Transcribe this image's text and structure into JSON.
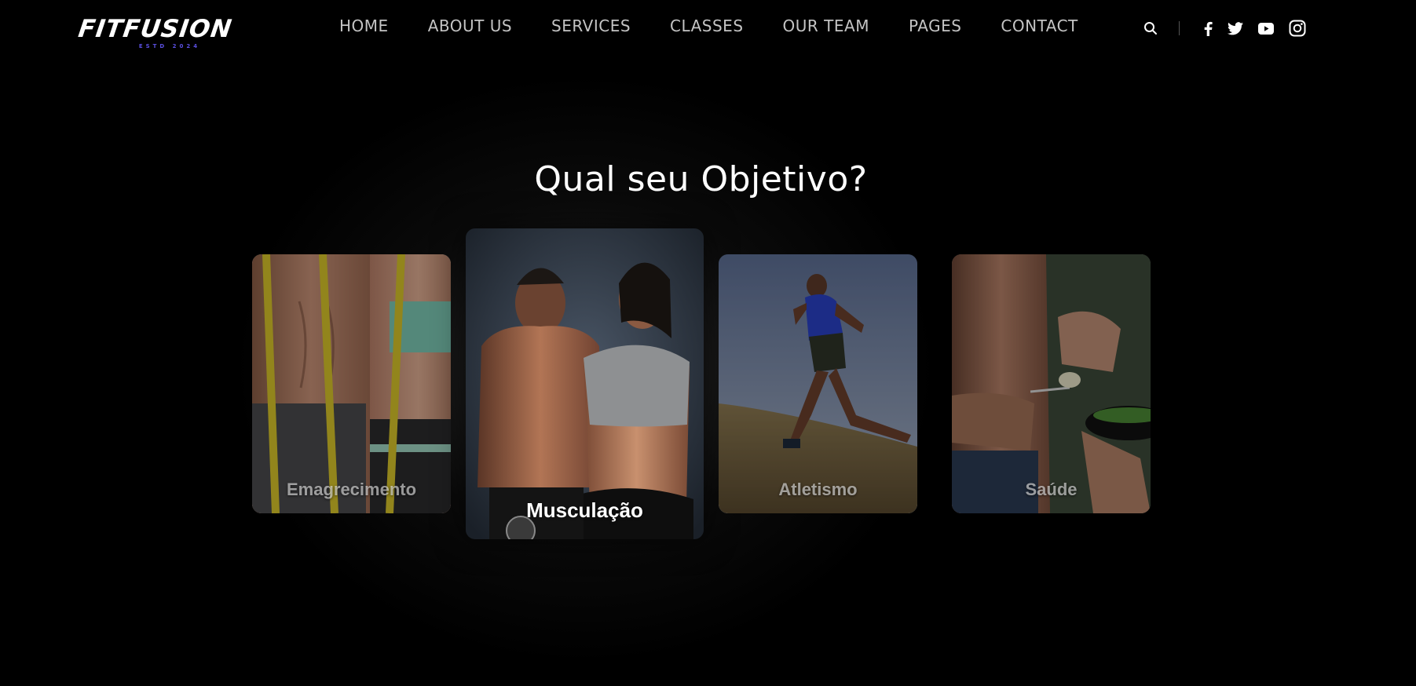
{
  "brand": {
    "name": "FITFUSION",
    "tagline": "ESTD 2024",
    "accent_color": "#5a4fe0"
  },
  "nav": {
    "items": [
      {
        "label": "HOME"
      },
      {
        "label": "ABOUT US"
      },
      {
        "label": "SERVICES"
      },
      {
        "label": "CLASSES"
      },
      {
        "label": "OUR TEAM"
      },
      {
        "label": "PAGES"
      },
      {
        "label": "CONTACT"
      }
    ]
  },
  "tools": {
    "search_icon": "search-icon",
    "social": [
      "facebook-icon",
      "twitter-icon",
      "youtube-icon",
      "instagram-icon"
    ]
  },
  "section": {
    "title": "Qual seu Objetivo?"
  },
  "cards": [
    {
      "label": "Emagrecimento",
      "image": "measuring-tape-abs-photo",
      "active": false
    },
    {
      "label": "Musculação",
      "image": "bodybuilder-couple-photo",
      "active": true
    },
    {
      "label": "Atletismo",
      "image": "runner-on-hill-photo",
      "active": false
    },
    {
      "label": "Saúde",
      "image": "healthy-eating-photo",
      "active": false
    }
  ],
  "colors": {
    "background": "#000000",
    "nav_text": "#c4c4c4",
    "title_text": "#ffffff"
  }
}
